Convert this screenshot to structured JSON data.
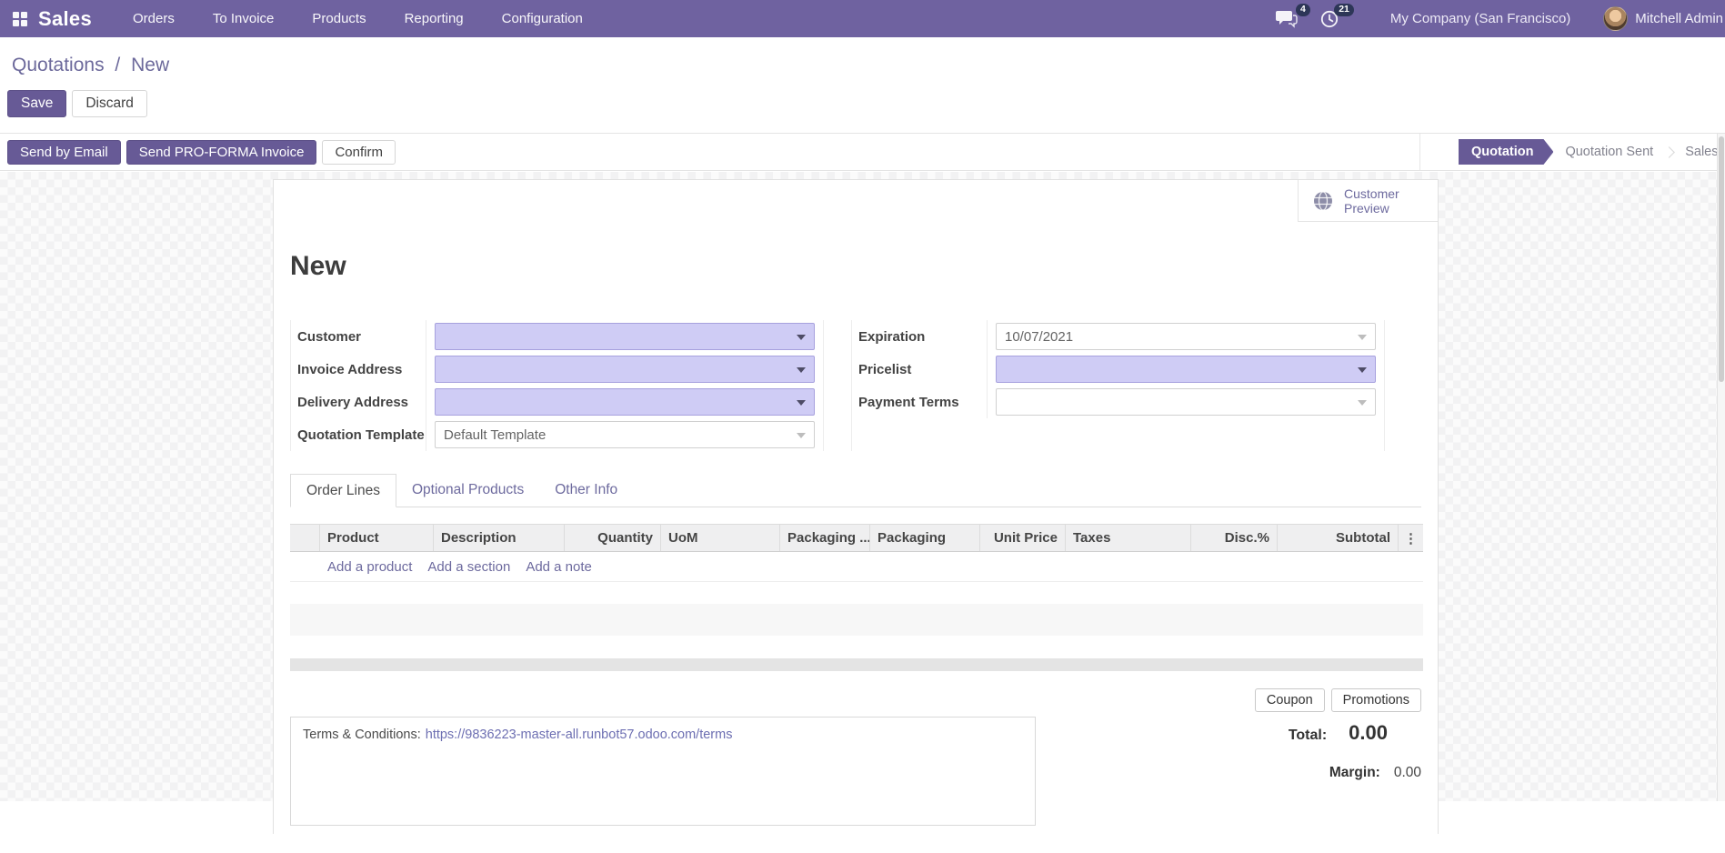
{
  "colors": {
    "navbar": "#6f62a0",
    "primary": "#675a96",
    "field_highlight": "#cfccf5",
    "link": "#6d6a9e"
  },
  "navbar": {
    "brand": "Sales",
    "items": [
      {
        "label": "Orders"
      },
      {
        "label": "To Invoice"
      },
      {
        "label": "Products"
      },
      {
        "label": "Reporting"
      },
      {
        "label": "Configuration"
      }
    ],
    "messages_badge": "4",
    "activities_badge": "21",
    "company": "My Company (San Francisco)",
    "user": "Mitchell Admin"
  },
  "breadcrumb": {
    "parent": "Quotations",
    "separator": "/",
    "current": "New"
  },
  "header_buttons": {
    "save": "Save",
    "discard": "Discard"
  },
  "action_buttons": {
    "send_by_email": "Send by Email",
    "send_proforma": "Send PRO-FORMA Invoice",
    "confirm": "Confirm"
  },
  "statusbar": {
    "steps": [
      {
        "label": "Quotation",
        "active": true
      },
      {
        "label": "Quotation Sent",
        "active": false
      },
      {
        "label": "Sales Order",
        "active": false
      }
    ]
  },
  "sheet": {
    "customer_preview": {
      "line1": "Customer",
      "line2": "Preview"
    },
    "title": "New",
    "fields_left": [
      {
        "label": "Customer",
        "value": ""
      },
      {
        "label": "Invoice Address",
        "value": ""
      },
      {
        "label": "Delivery Address",
        "value": ""
      },
      {
        "label": "Quotation Template",
        "value": "Default Template"
      }
    ],
    "fields_right": [
      {
        "label": "Expiration",
        "value": "10/07/2021"
      },
      {
        "label": "Pricelist",
        "value": ""
      },
      {
        "label": "Payment Terms",
        "value": ""
      }
    ],
    "tabs": [
      {
        "label": "Order Lines",
        "active": true
      },
      {
        "label": "Optional Products",
        "active": false
      },
      {
        "label": "Other Info",
        "active": false
      }
    ],
    "order_lines": {
      "columns": [
        "",
        "Product",
        "Description",
        "Quantity",
        "UoM",
        "Packaging ...",
        "Packaging",
        "Unit Price",
        "Taxes",
        "Disc.%",
        "Subtotal"
      ],
      "options_icon": "⋮",
      "add_links": [
        "Add a product",
        "Add a section",
        "Add a note"
      ]
    },
    "footer": {
      "terms_label": "Terms & Conditions:",
      "terms_link": "https://9836223-master-all.runbot57.odoo.com/terms",
      "coupon": "Coupon",
      "promotions": "Promotions",
      "total_label": "Total:",
      "total_value": "0.00",
      "margin_label": "Margin:",
      "margin_value": "0.00"
    }
  }
}
